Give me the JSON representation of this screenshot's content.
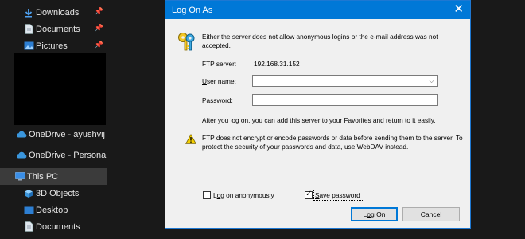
{
  "nav": {
    "items": [
      {
        "label": "Downloads",
        "icon": "download-arrow-icon",
        "pinned": true
      },
      {
        "label": "Documents",
        "icon": "document-icon",
        "pinned": true
      },
      {
        "label": "Pictures",
        "icon": "picture-icon",
        "pinned": true
      },
      {
        "label": "OneDrive - ayushvij",
        "icon": "cloud-icon"
      },
      {
        "label": "OneDrive - Personal",
        "icon": "cloud-icon"
      },
      {
        "label": "This PC",
        "icon": "computer-icon"
      },
      {
        "label": "3D Objects",
        "icon": "cube-icon"
      },
      {
        "label": "Desktop",
        "icon": "desktop-icon"
      },
      {
        "label": "Documents",
        "icon": "document-icon"
      }
    ]
  },
  "dialog": {
    "title": "Log On As",
    "close_glyph": "✕",
    "intro": "Either the server does not allow anonymous logins or the e-mail address was not accepted.",
    "ftp_server_label": "FTP server:",
    "ftp_server_value": "192.168.31.152",
    "username_label_u": "U",
    "username_label_rest": "ser name:",
    "username_value": "",
    "password_label_u": "P",
    "password_label_rest": "assword:",
    "password_value": "",
    "after_logon": "After you log on, you can add this server to your Favorites and return to it easily.",
    "warning": "FTP does not encrypt or encode passwords or data before sending them to the server.  To protect the security of your passwords and data, use WebDAV instead.",
    "anon_label_pre": "L",
    "anon_label_u": "o",
    "anon_label_rest": "g on anonymously",
    "anon_checked": false,
    "save_label_u": "S",
    "save_label_rest": "ave password",
    "save_checked": true,
    "logon_button_pre": "L",
    "logon_button_u": "o",
    "logon_button_rest": "g On",
    "cancel_button": "Cancel"
  },
  "colors": {
    "titlebar": "#0078d7",
    "explorer_bg": "#191919",
    "dialog_bg": "#f0f0f0"
  }
}
